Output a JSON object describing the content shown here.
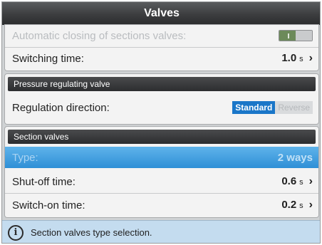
{
  "window": {
    "title": "Valves"
  },
  "sections": {
    "general": {
      "auto_close_label": "Automatic closing of sections valves:",
      "auto_close_state": "on",
      "switching_time_label": "Switching time:",
      "switching_time_value": "1.0",
      "switching_time_unit": "s"
    },
    "pressure": {
      "header": "Pressure regulating valve",
      "direction_label": "Regulation direction:",
      "options": [
        "Standard",
        "Reverse"
      ],
      "selected": "Standard"
    },
    "section_valves": {
      "header": "Section valves",
      "type_label": "Type:",
      "type_value": "2 ways",
      "shutoff_label": "Shut-off time:",
      "shutoff_value": "0.6",
      "shutoff_unit": "s",
      "switchon_label": "Switch-on time:",
      "switchon_value": "0.2",
      "switchon_unit": "s"
    }
  },
  "status": {
    "icon": "info-icon",
    "message": "Section valves type selection."
  },
  "colors": {
    "accent": "#1a76c8",
    "selected_row": "#3a97dc",
    "status_bar": "#c4dcef",
    "title_bar": "#3c3d3f"
  }
}
